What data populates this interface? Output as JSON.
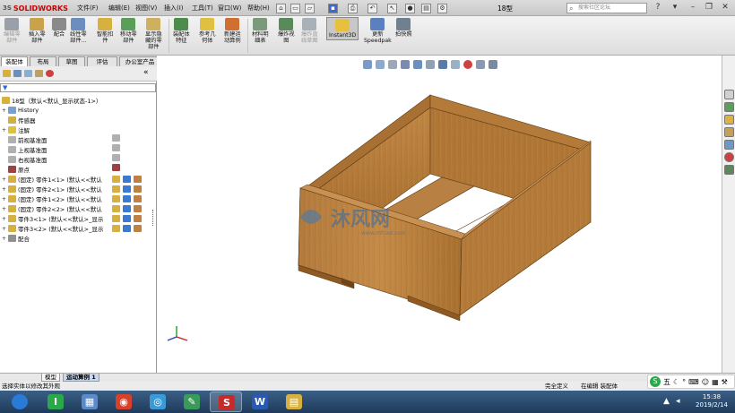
{
  "app": {
    "brand": "SOLIDWORKS",
    "brand_prefix": "3S",
    "document_title": "18型",
    "search_placeholder": "搜索社区论坛"
  },
  "menus": [
    {
      "label": "文件(F)"
    },
    {
      "label": "编辑(E)"
    },
    {
      "label": "视图(V)"
    },
    {
      "label": "插入(I)"
    },
    {
      "label": "工具(T)"
    },
    {
      "label": "窗口(W)"
    },
    {
      "label": "帮助(H)"
    }
  ],
  "command_manager": [
    {
      "label": "编辑零\n部件",
      "disabled": true,
      "color": "#9aa0a8"
    },
    {
      "label": "插入零\n部件",
      "disabled": false,
      "color": "#c9a24a"
    },
    {
      "label": "配合",
      "disabled": false,
      "color": "#8a8a8a"
    },
    {
      "label": "线性零\n部件...",
      "disabled": false,
      "color": "#6c8ebf"
    },
    {
      "label": "智能扣\n件",
      "disabled": false,
      "color": "#d8b040"
    },
    {
      "label": "移动零\n部件",
      "disabled": false,
      "color": "#5a9e5a"
    },
    {
      "label": "显示隐\n藏的零\n部件",
      "disabled": false,
      "color": "#cfb060"
    },
    {
      "label": "装配体\n特征",
      "disabled": false,
      "color": "#4c8c4c"
    },
    {
      "label": "参考几\n何体",
      "disabled": false,
      "color": "#e0c040"
    },
    {
      "label": "新建运\n动算例",
      "disabled": false,
      "color": "#d07030"
    },
    {
      "label": "材料明\n细表",
      "disabled": false,
      "color": "#7a9a7a"
    },
    {
      "label": "爆炸视\n图",
      "disabled": false,
      "color": "#5a8a5a"
    },
    {
      "label": "爆炸直\n线草图",
      "disabled": true,
      "color": "#a8b0b8"
    },
    {
      "label": "Instant3D",
      "disabled": false,
      "color": "#e8c040"
    },
    {
      "label": "更新\nSpeedpak",
      "disabled": false,
      "color": "#5a80c0"
    },
    {
      "label": "拍快照",
      "disabled": false,
      "color": "#708090"
    }
  ],
  "panel_tabs": [
    {
      "label": "装配体",
      "active": true
    },
    {
      "label": "布局",
      "active": false
    },
    {
      "label": "草图",
      "active": false
    },
    {
      "label": "评估",
      "active": false
    },
    {
      "label": "办公室产品",
      "active": false
    }
  ],
  "feature_tree": {
    "root": "18型（默认<默认_显示状态-1>）",
    "items": [
      {
        "label": "History",
        "expander": "+",
        "icon": "#7aa0d0"
      },
      {
        "label": "传感器",
        "expander": "",
        "icon": "#d0b040"
      },
      {
        "label": "注解",
        "expander": "+",
        "icon": "#e0c040"
      },
      {
        "label": "前视基准面",
        "expander": "",
        "icon": "#b0b0b0"
      },
      {
        "label": "上视基准面",
        "expander": "",
        "icon": "#b0b0b0"
      },
      {
        "label": "右视基准面",
        "expander": "",
        "icon": "#b0b0b0"
      },
      {
        "label": "原点",
        "expander": "",
        "icon": "#a04040"
      },
      {
        "label": "(固定) 零件1<1> (默认<<默认",
        "expander": "+",
        "icon": "#d8b040"
      },
      {
        "label": "(固定) 零件2<1> (默认<<默认",
        "expander": "+",
        "icon": "#d8b040"
      },
      {
        "label": "(固定) 零件1<2> (默认<<默认",
        "expander": "+",
        "icon": "#d8b040"
      },
      {
        "label": "(固定) 零件2<2> (默认<<默认",
        "expander": "+",
        "icon": "#d8b040"
      },
      {
        "label": "零件3<1> (默认<<默认>_显示",
        "expander": "+",
        "icon": "#d8b040"
      },
      {
        "label": "零件3<2> (默认<<默认>_显示",
        "expander": "+",
        "icon": "#d8b040"
      },
      {
        "label": "配合",
        "expander": "+",
        "icon": "#909090"
      }
    ]
  },
  "bottom_tabs": [
    {
      "label": "模型",
      "active": false
    },
    {
      "label": "运动算例 1",
      "active": true
    }
  ],
  "status": {
    "left": "选择实体以修改其外观",
    "defined": "完全定义",
    "editing": "在编辑 装配体"
  },
  "watermark": {
    "text": "沐风网",
    "subtext": "www.mfcad.com"
  },
  "taskbar": {
    "apps": [
      {
        "name": "start-button-icon",
        "glyph": "",
        "color": "#2a7ad8"
      },
      {
        "name": "ie-icon-taskbar",
        "glyph": "I",
        "color": "#2aa84a"
      },
      {
        "name": "calculator-icon",
        "glyph": "▦",
        "color": "#5a8ac8"
      },
      {
        "name": "chrome-icon",
        "glyph": "◉",
        "color": "#d8402a"
      },
      {
        "name": "network-icon",
        "glyph": "◎",
        "color": "#3a9ad8"
      },
      {
        "name": "feather-icon",
        "glyph": "✎",
        "color": "#3a9a5a"
      },
      {
        "name": "solidworks-icon",
        "glyph": "S",
        "color": "#c82a2a"
      },
      {
        "name": "word-icon",
        "glyph": "W",
        "color": "#2a5ab0"
      },
      {
        "name": "explorer-icon",
        "glyph": "▤",
        "color": "#d8b040"
      }
    ],
    "time": "15:38",
    "date": "2019/2/14",
    "ime_label": "五"
  }
}
